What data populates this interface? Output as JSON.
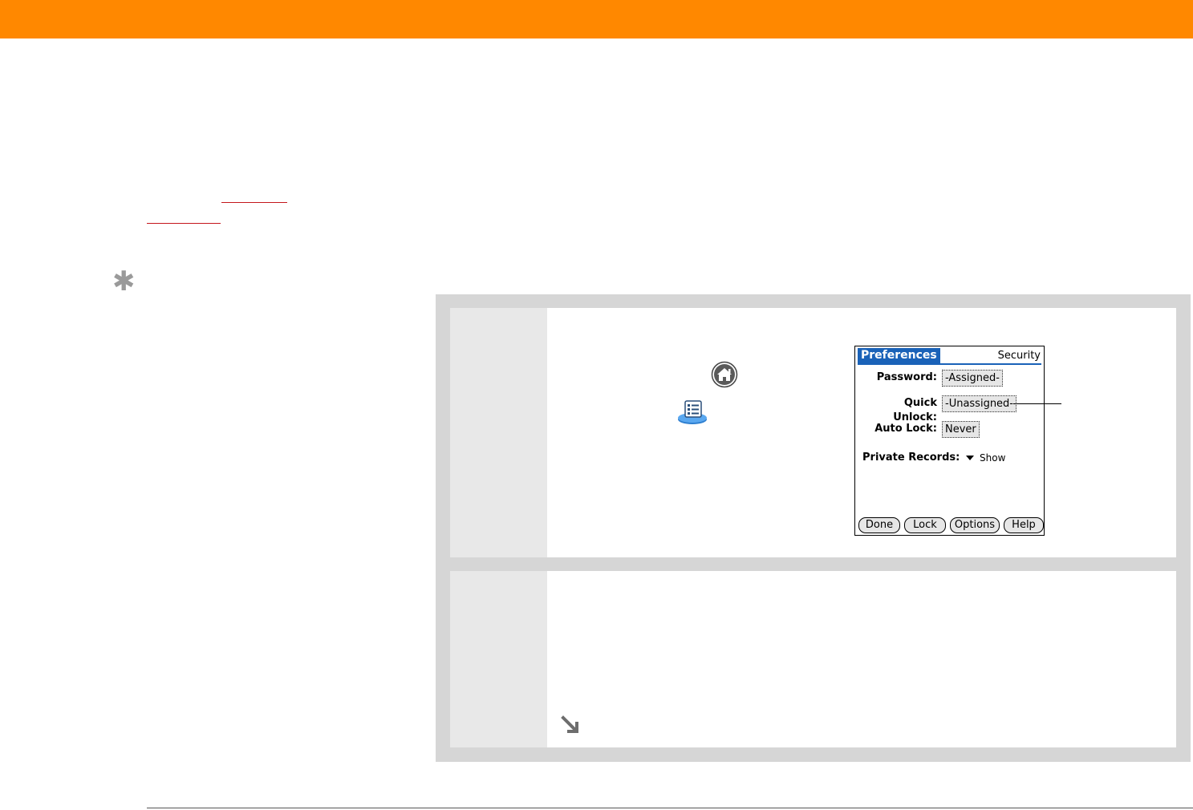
{
  "header": {
    "bar_color": "#ff8800"
  },
  "sidebar": {
    "link_color": "#c4161c",
    "tip_icon": "asterisk-tip-icon"
  },
  "steps": [
    {
      "home_icon": "home-icon",
      "app_icon": "prefs-app-icon"
    },
    {
      "continue_icon": "arrow-down-right-icon"
    }
  ],
  "palm_screen": {
    "title": "Preferences",
    "section": "Security",
    "password_label": "Password:",
    "password_value": "-Assigned-",
    "quick_unlock_label": "Quick Unlock:",
    "quick_unlock_value": "-Unassigned-",
    "auto_lock_label": "Auto Lock:",
    "auto_lock_value": "Never",
    "private_records_label": "Private Records:",
    "private_records_value": "Show",
    "buttons": [
      "Done",
      "Lock",
      "Options",
      "Help"
    ],
    "accent_color": "#1a62b8"
  }
}
